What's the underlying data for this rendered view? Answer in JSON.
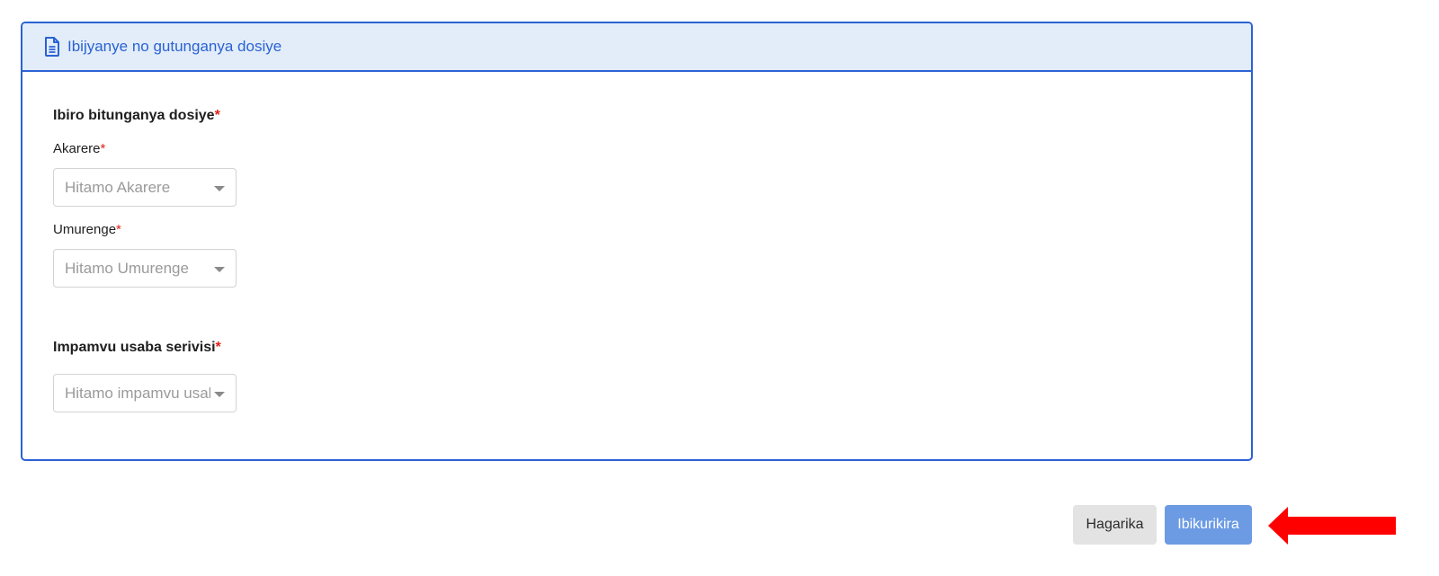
{
  "card": {
    "header_title": "Ibijyanye no gutunganya dosiye",
    "header_icon": "document-icon"
  },
  "office_section": {
    "label": "Ibiro bitunganya dosiye",
    "required_mark": "*",
    "district": {
      "label": "Akarere",
      "required_mark": "*",
      "placeholder": "Hitamo Akarere"
    },
    "sector": {
      "label": "Umurenge",
      "required_mark": "*",
      "placeholder": "Hitamo Umurenge"
    }
  },
  "reason_section": {
    "label": "Impamvu usaba serivisi",
    "required_mark": "*",
    "placeholder": "Hitamo impamvu usaba serivisi"
  },
  "actions": {
    "cancel_label": "Hagarika",
    "submit_label": "Ibikurikira"
  },
  "annotation": {
    "arrow_icon": "red-arrow-left-icon",
    "arrow_color": "#ff0000"
  },
  "colors": {
    "accent": "#2a62d4",
    "header_bg": "#e3edf9",
    "submit_bg": "#6c9be4",
    "cancel_bg": "#e3e3e3",
    "required": "#e0201a"
  }
}
